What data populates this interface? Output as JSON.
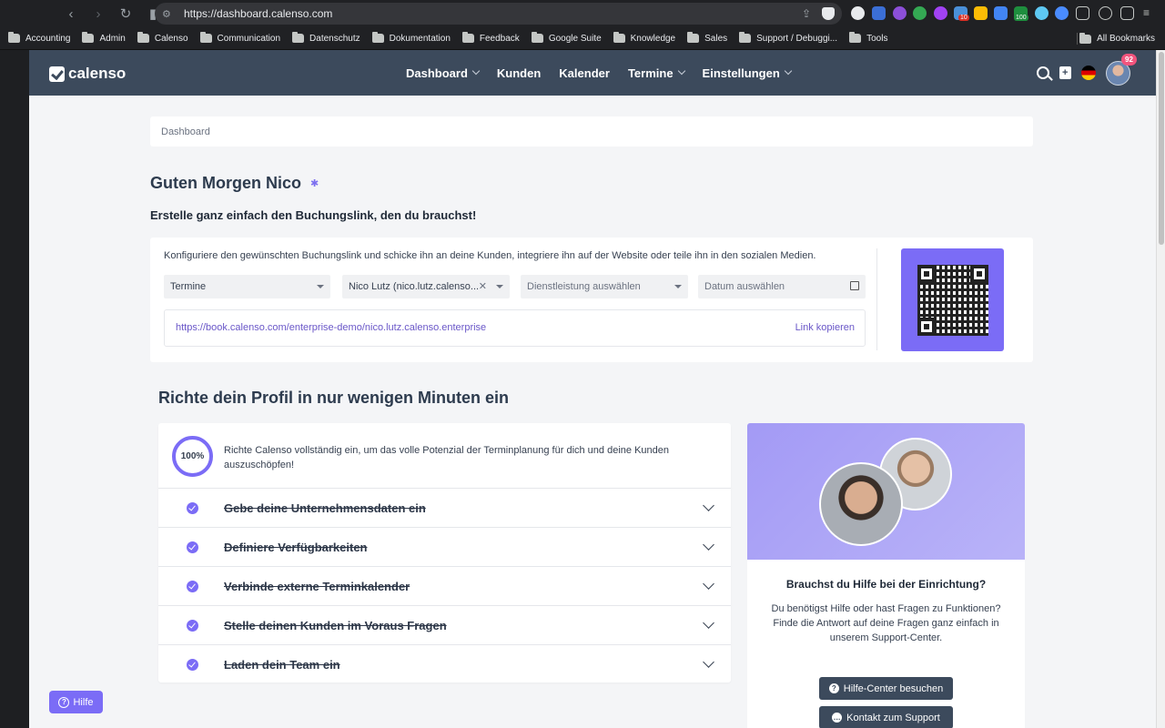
{
  "browser": {
    "url": "https://dashboard.calenso.com",
    "badges": {
      "red": "10",
      "green": "100"
    },
    "bookmarks": [
      "Accounting",
      "Admin",
      "Calenso",
      "Communication",
      "Datenschutz",
      "Dokumentation",
      "Feedback",
      "Google Suite",
      "Knowledge",
      "Sales",
      "Support / Debuggi...",
      "Tools"
    ],
    "all_bookmarks": "All Bookmarks"
  },
  "header": {
    "logo": "calenso",
    "nav": [
      {
        "label": "Dashboard",
        "dropdown": true
      },
      {
        "label": "Kunden",
        "dropdown": false
      },
      {
        "label": "Kalender",
        "dropdown": false
      },
      {
        "label": "Termine",
        "dropdown": true
      },
      {
        "label": "Einstellungen",
        "dropdown": true
      }
    ],
    "notification_count": "92"
  },
  "breadcrumb": "Dashboard",
  "greeting": "Guten Morgen Nico",
  "subtitle": "Erstelle ganz einfach den Buchungslink, den du brauchst!",
  "link_builder": {
    "description": "Konfiguriere den gewünschten Buchungslink und schicke ihn an deine Kunden, integriere ihn auf der Website oder teile ihn in den sozialen Medien.",
    "type_select": "Termine",
    "worker_select": "Nico Lutz (nico.lutz.calenso...",
    "service_placeholder": "Dienstleistung auswählen",
    "date_placeholder": "Datum auswählen",
    "link": "https://book.calenso.com/enterprise-demo/nico.lutz.calenso.enterprise",
    "copy_label": "Link kopieren"
  },
  "setup": {
    "title": "Richte dein Profil in nur wenigen Minuten ein",
    "progress": "100%",
    "intro": "Richte Calenso vollständig ein, um das volle Potenzial der Terminplanung für dich und deine Kunden auszuschöpfen!",
    "steps": [
      "Gebe deine Unternehmensdaten ein",
      "Definiere Verfügbarkeiten",
      "Verbinde externe Terminkalender",
      "Stelle deinen Kunden im Voraus Fragen",
      "Laden dein Team ein"
    ]
  },
  "help": {
    "title": "Brauchst du Hilfe bei der Einrichtung?",
    "text": "Du benötigst Hilfe oder hast Fragen zu Funktionen? Finde die Antwort auf deine Fragen ganz einfach in unserem Support-Center.",
    "help_center_button": "Hilfe-Center besuchen",
    "support_button": "Kontakt zum Support"
  },
  "floating_help": "Hilfe",
  "colors": {
    "header": "#3c4a5c",
    "accent": "#7b6cf6",
    "link": "#6a57c8"
  }
}
